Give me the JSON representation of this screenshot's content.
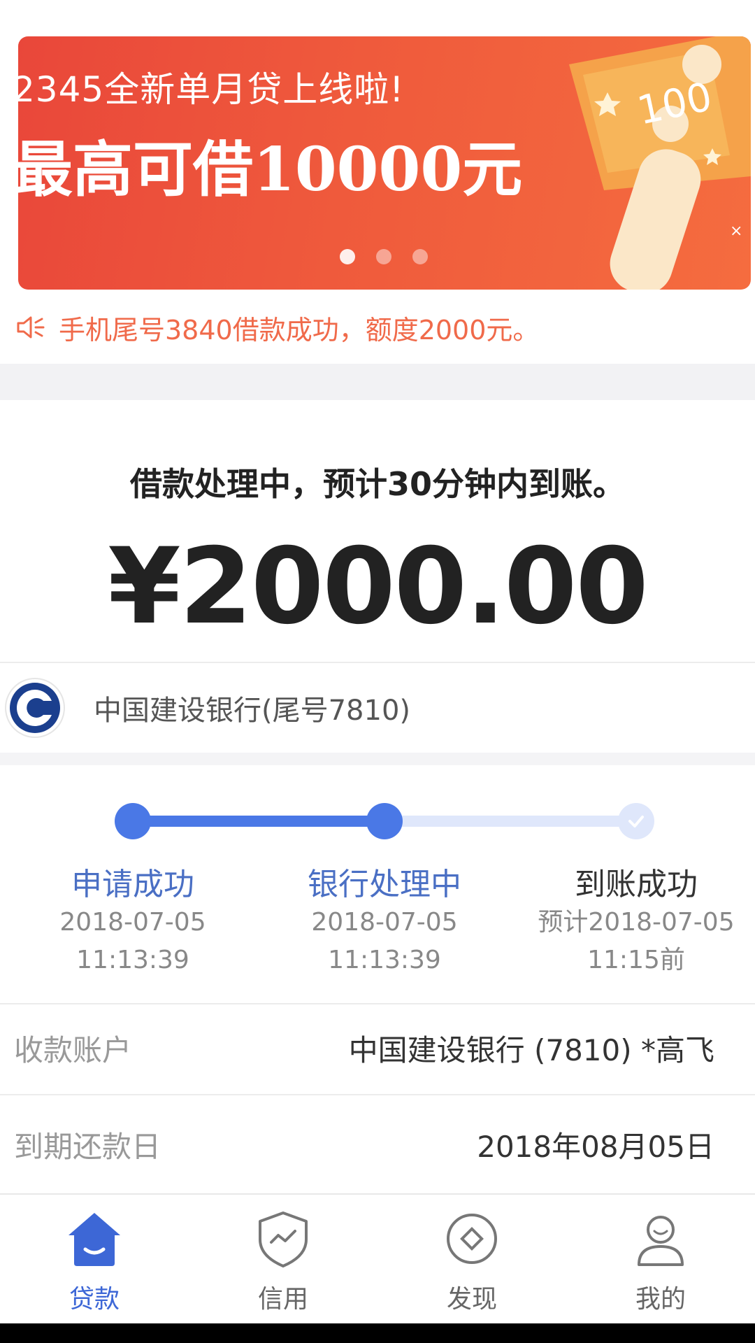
{
  "banner": {
    "line1": "2345全新单月贷上线啦!",
    "line2": "最高可借10000元",
    "note_value": "100"
  },
  "notice": {
    "text": "手机尾号3840借款成功，额度2000元。"
  },
  "status": {
    "title": "借款处理中，预计30分钟内到账。",
    "amount": "¥2000.00"
  },
  "bank": {
    "text": "中国建设银行(尾号7810)"
  },
  "progress": {
    "steps": [
      {
        "label": "申请成功",
        "date": "2018-07-05",
        "time": "11:13:39"
      },
      {
        "label": "银行处理中",
        "date": "2018-07-05",
        "time": "11:13:39"
      },
      {
        "label": "到账成功",
        "date": "预计2018-07-05",
        "time": "11:15前"
      }
    ]
  },
  "info": {
    "account_label": "收款账户",
    "account_value": "中国建设银行 (7810)  *高飞",
    "due_label": "到期还款日",
    "due_value": "2018年08月05日"
  },
  "tabs": [
    {
      "label": "贷款",
      "icon": "home-icon"
    },
    {
      "label": "信用",
      "icon": "shield-icon"
    },
    {
      "label": "发现",
      "icon": "compass-icon"
    },
    {
      "label": "我的",
      "icon": "user-icon"
    }
  ],
  "colors": {
    "accent": "#4a78e6",
    "banner": "#ef5a3c",
    "notice": "#f06a4a"
  }
}
